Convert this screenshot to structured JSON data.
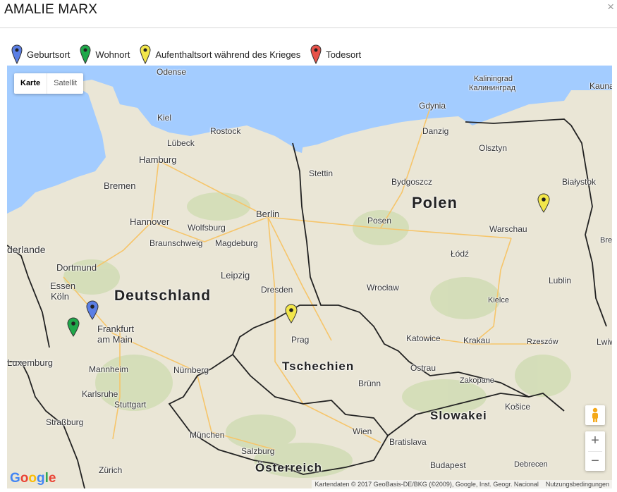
{
  "dialog": {
    "title": "AMALIE MARX",
    "close": "×"
  },
  "legend": [
    {
      "label": "Geburtsort",
      "color": "#5b7fe5"
    },
    {
      "label": "Wohnort",
      "color": "#1fa84a"
    },
    {
      "label": "Aufenthaltsort während des Krieges",
      "color": "#f2e64a"
    },
    {
      "label": "Todesort",
      "color": "#e8524a"
    }
  ],
  "map": {
    "type_buttons": {
      "map": "Karte",
      "satellite": "Satellit"
    },
    "zoom_in": "+",
    "zoom_out": "−",
    "google": "Google",
    "attribution": "Kartendaten © 2017 GeoBasis-DE/BKG (©2009), Google, Inst. Geogr. Nacional",
    "terms": "Nutzungsbedingungen",
    "countries": [
      "Deutschland",
      "Polen",
      "Tschechien",
      "Slowakei",
      "Österreich"
    ],
    "cities": [
      "Odense",
      "Kaliningrad",
      "Калининград",
      "Kaunas",
      "Gdynia",
      "Danzig",
      "Kiel",
      "Rostock",
      "Olsztyn",
      "Lübeck",
      "Hamburg",
      "Stettin",
      "Bydgoszcz",
      "Białystok",
      "Bremen",
      "Hannover",
      "Wolfsburg",
      "Berlin",
      "Posen",
      "Warschau",
      "Braunschweig",
      "Magdeburg",
      "Łódź",
      "Dortmund",
      "Essen",
      "Köln",
      "Leipzig",
      "Dresden",
      "Wrocław",
      "Lublin",
      "Kielce",
      "Frankfurt am Main",
      "Prag",
      "Katowice",
      "Krakau",
      "Rzeszów",
      "Luxemburg",
      "Mannheim",
      "Nürnberg",
      "Ostrau",
      "Zakopane",
      "Brünn",
      "Karlsruhe",
      "Stuttgart",
      "Košice",
      "Straßburg",
      "München",
      "Wien",
      "Bratislava",
      "Salzburg",
      "Zürich",
      "Budapest",
      "Debrecen",
      "Lwiw",
      "Brest",
      "derlande"
    ],
    "markers": [
      {
        "type": "Geburtsort",
        "color": "#5b7fe5"
      },
      {
        "type": "Wohnort",
        "color": "#1fa84a"
      },
      {
        "type": "Aufenthaltsort während des Krieges",
        "color": "#f2e64a"
      },
      {
        "type": "Aufenthaltsort während des Krieges",
        "color": "#f2e64a"
      }
    ]
  }
}
